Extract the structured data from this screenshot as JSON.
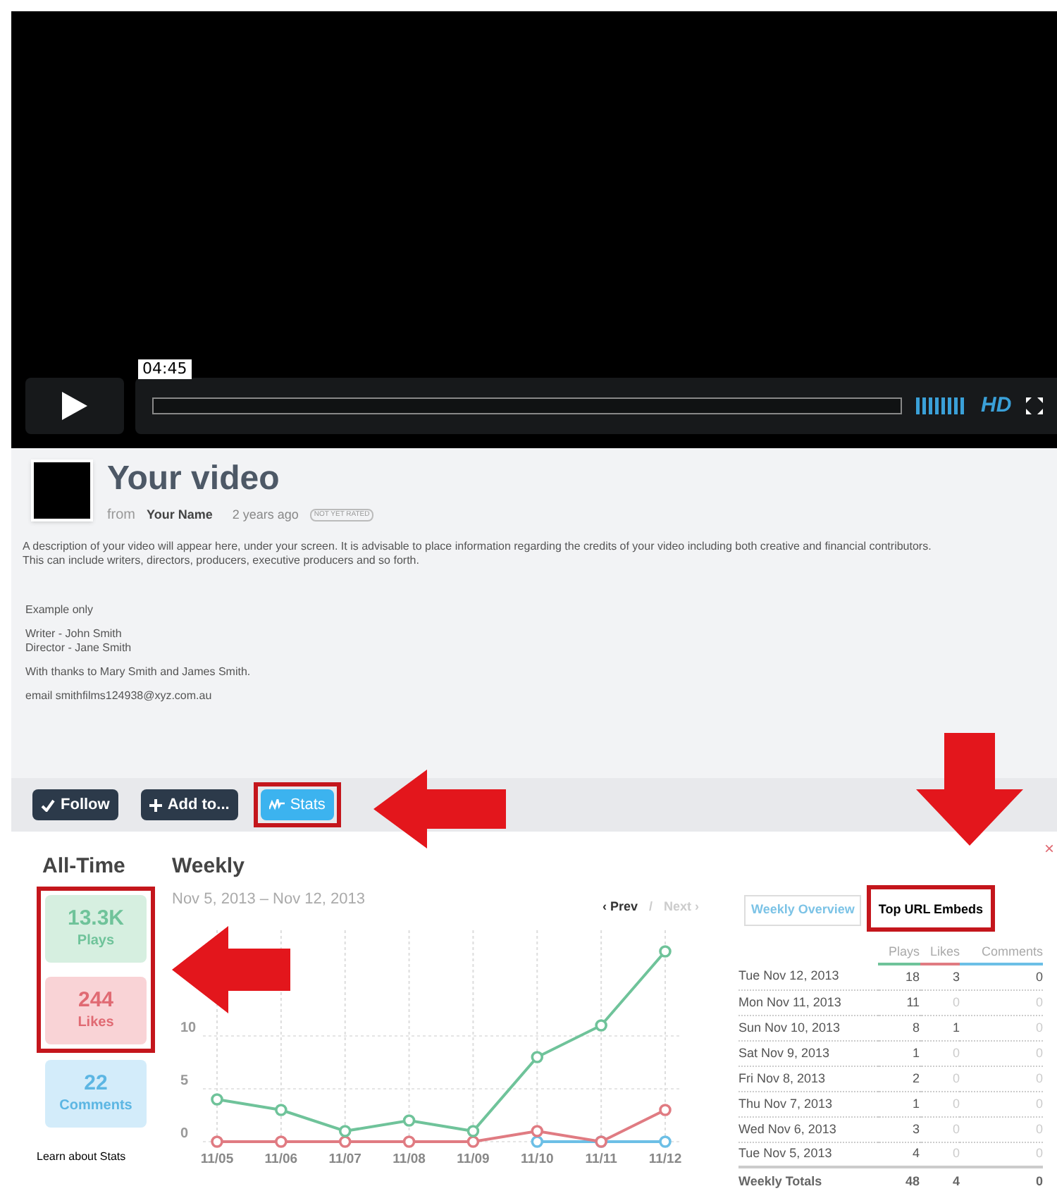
{
  "video": {
    "time": "04:45",
    "hd_label": "HD"
  },
  "info": {
    "title": "Your video",
    "from": "from",
    "author": "Your Name",
    "age": "2 years ago",
    "rating": "NOT YET RATED",
    "paragraphs": [
      [
        "A description of your video will appear here, under your screen. It is advisable to place information regarding the credits of your video including both creative and financial contributors.",
        "This can include writers, directors, producers, executive producers and so forth."
      ],
      [
        "Example only"
      ],
      [
        "Writer - John Smith",
        "Director - Jane Smith"
      ],
      [
        "With thanks to Mary Smith and James Smith."
      ],
      [
        "email smithfilms124938@xyz.com.au"
      ]
    ]
  },
  "actions": [
    {
      "label": "Follow",
      "kind": "check",
      "selected": false,
      "highlighted": false
    },
    {
      "label": "Add to...",
      "kind": "plus",
      "selected": false,
      "highlighted": false
    },
    {
      "label": "Stats",
      "kind": "stats",
      "selected": true,
      "highlighted": true
    }
  ],
  "stats": {
    "all_time_title": "All-Time",
    "totals": [
      {
        "value": "13.3K",
        "label": "Plays",
        "kind": "plays",
        "highlighted": true
      },
      {
        "value": "244",
        "label": "Likes",
        "kind": "likes",
        "highlighted": true
      },
      {
        "value": "22",
        "label": "Comments",
        "kind": "comments",
        "highlighted": false
      }
    ],
    "learn_link": "Learn about Stats",
    "weekly_title": "Weekly",
    "range": "Nov 5, 2013 – Nov 12, 2013",
    "prev": "‹ Prev",
    "separator": "/",
    "next": "Next ›",
    "close": "×",
    "tabs": [
      {
        "label": "Weekly Overview",
        "selected": false,
        "highlighted": false
      },
      {
        "label": "Top URL Embeds",
        "selected": true,
        "highlighted": true
      }
    ],
    "chart_data": {
      "type": "line",
      "categories": [
        "11/05",
        "11/06",
        "11/07",
        "11/08",
        "11/09",
        "11/10",
        "11/11",
        "11/12"
      ],
      "series": [
        {
          "name": "Plays",
          "color": "#6fc39a",
          "marker": "circle",
          "values": [
            4,
            3,
            1,
            2,
            1,
            8,
            11,
            18
          ]
        },
        {
          "name": "Likes",
          "color": "#e07b82",
          "marker": "circle",
          "values": [
            0,
            0,
            0,
            0,
            0,
            1,
            0,
            3
          ]
        },
        {
          "name": "Comments",
          "color": "#6cbfe6",
          "marker": "circle",
          "values": [
            null,
            null,
            null,
            null,
            null,
            0,
            0,
            0
          ]
        }
      ],
      "grid": true,
      "ylim": [
        0,
        20
      ],
      "yticks": [
        0,
        5,
        10
      ]
    },
    "table": {
      "rows": [
        {
          "day": "Tue Nov 12, 2013",
          "values": [
            "18",
            "3",
            "0"
          ]
        },
        {
          "day": "Mon Nov 11, 2013",
          "values": [
            "11",
            "0",
            "0"
          ]
        },
        {
          "day": "Sun Nov 10, 2013",
          "values": [
            "8",
            "1",
            "0"
          ]
        },
        {
          "day": "Sat Nov 9, 2013",
          "values": [
            "1",
            "0",
            "0"
          ]
        },
        {
          "day": "Fri Nov 8, 2013",
          "values": [
            "2",
            "0",
            "0"
          ]
        },
        {
          "day": "Thu Nov 7, 2013",
          "values": [
            "1",
            "0",
            "0"
          ]
        },
        {
          "day": "Wed Nov 6, 2013",
          "values": [
            "3",
            "0",
            "0"
          ]
        },
        {
          "day": "Tue Nov 5, 2013",
          "values": [
            "4",
            "0",
            "0"
          ]
        }
      ],
      "totals": {
        "label": "Weekly Totals",
        "values": [
          "48",
          "4",
          "0"
        ]
      }
    }
  }
}
